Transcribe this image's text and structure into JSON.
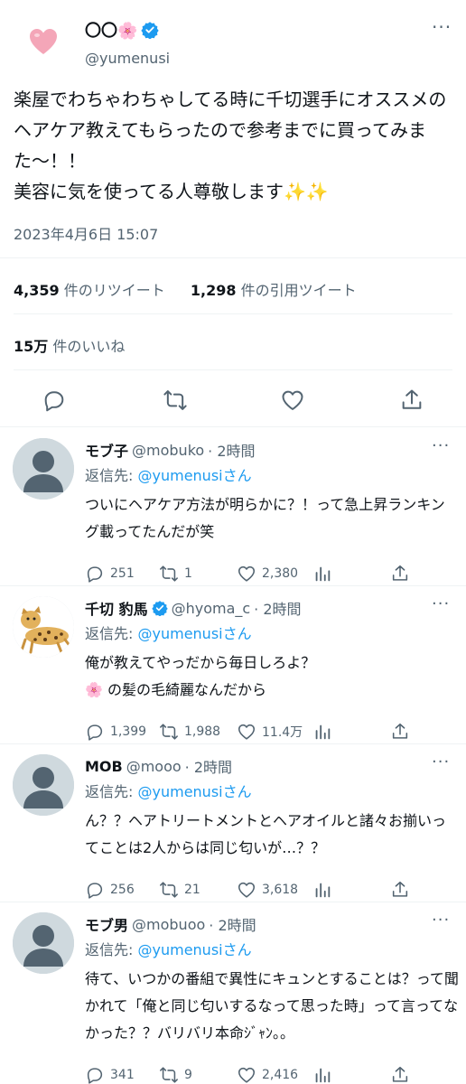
{
  "main_tweet": {
    "display_name": "〇〇🌸",
    "handle": "@yumenusi",
    "text": "楽屋でわちゃわちゃしてる時に千切選手にオススメのヘアケア教えてもらったので参考までに買ってみまた〜！！\n美容に気を使ってる人尊敬します✨✨",
    "date": "2023年4月6日 15:07",
    "retweet_count": "4,359",
    "retweet_label": "件のリツイート",
    "quote_count": "1,298",
    "quote_label": "件の引用ツイート",
    "like_count": "15万",
    "like_label": "件のいいね",
    "more": "···"
  },
  "replies": [
    {
      "name": "モブ子",
      "handle": "@mobuko",
      "time": "· 2時間",
      "reply_to_label": "返信先:",
      "reply_to": "@yumenusiさん",
      "text": "ついにヘアケア方法が明らかに？！って急上昇ランキング載ってたんだが笑",
      "replies": "251",
      "retweets": "1",
      "likes": "2,380",
      "more": "···"
    },
    {
      "name": "千切 豹馬",
      "handle": "@hyoma_c",
      "time": "· 2時間",
      "reply_to_label": "返信先:",
      "reply_to": "@yumenusiさん",
      "text": "俺が教えてやっだから毎日しろよ？\n🌸 の髪の毛綺麗なんだから",
      "replies": "1,399",
      "retweets": "1,988",
      "likes": "11.4万",
      "more": "···"
    },
    {
      "name": "MOB",
      "handle": "@mooo",
      "time": "· 2時間",
      "reply_to_label": "返信先:",
      "reply_to": "@yumenusiさん",
      "text": "ん？？ヘアトリートメントとヘアオイルと諸々お揃いってことは2人からは同じ匂いが…？？",
      "replies": "256",
      "retweets": "21",
      "likes": "3,618",
      "more": "···"
    },
    {
      "name": "モブ男",
      "handle": "@mobuoo",
      "time": "· 2時間",
      "reply_to_label": "返信先:",
      "reply_to": "@yumenusiさん",
      "text": "待て、いつかの番組で異性にキュンとすることは？って聞かれて「俺と同じ匂いするなって思った時」って言ってなかった？？バリバリ本命ｼﾞｬﾝ。。",
      "replies": "341",
      "retweets": "9",
      "likes": "2,416",
      "more": "···"
    }
  ],
  "icons": {
    "reply": "reply-icon",
    "retweet": "retweet-icon",
    "like": "heart-icon",
    "share": "share-icon",
    "analytics": "analytics-icon",
    "verified": "verified-badge-icon"
  },
  "colors": {
    "accent": "#1d9bf0",
    "secondary_text": "#536471",
    "divider": "#eff3f4",
    "avatar_heart": "#f4a6b8"
  }
}
